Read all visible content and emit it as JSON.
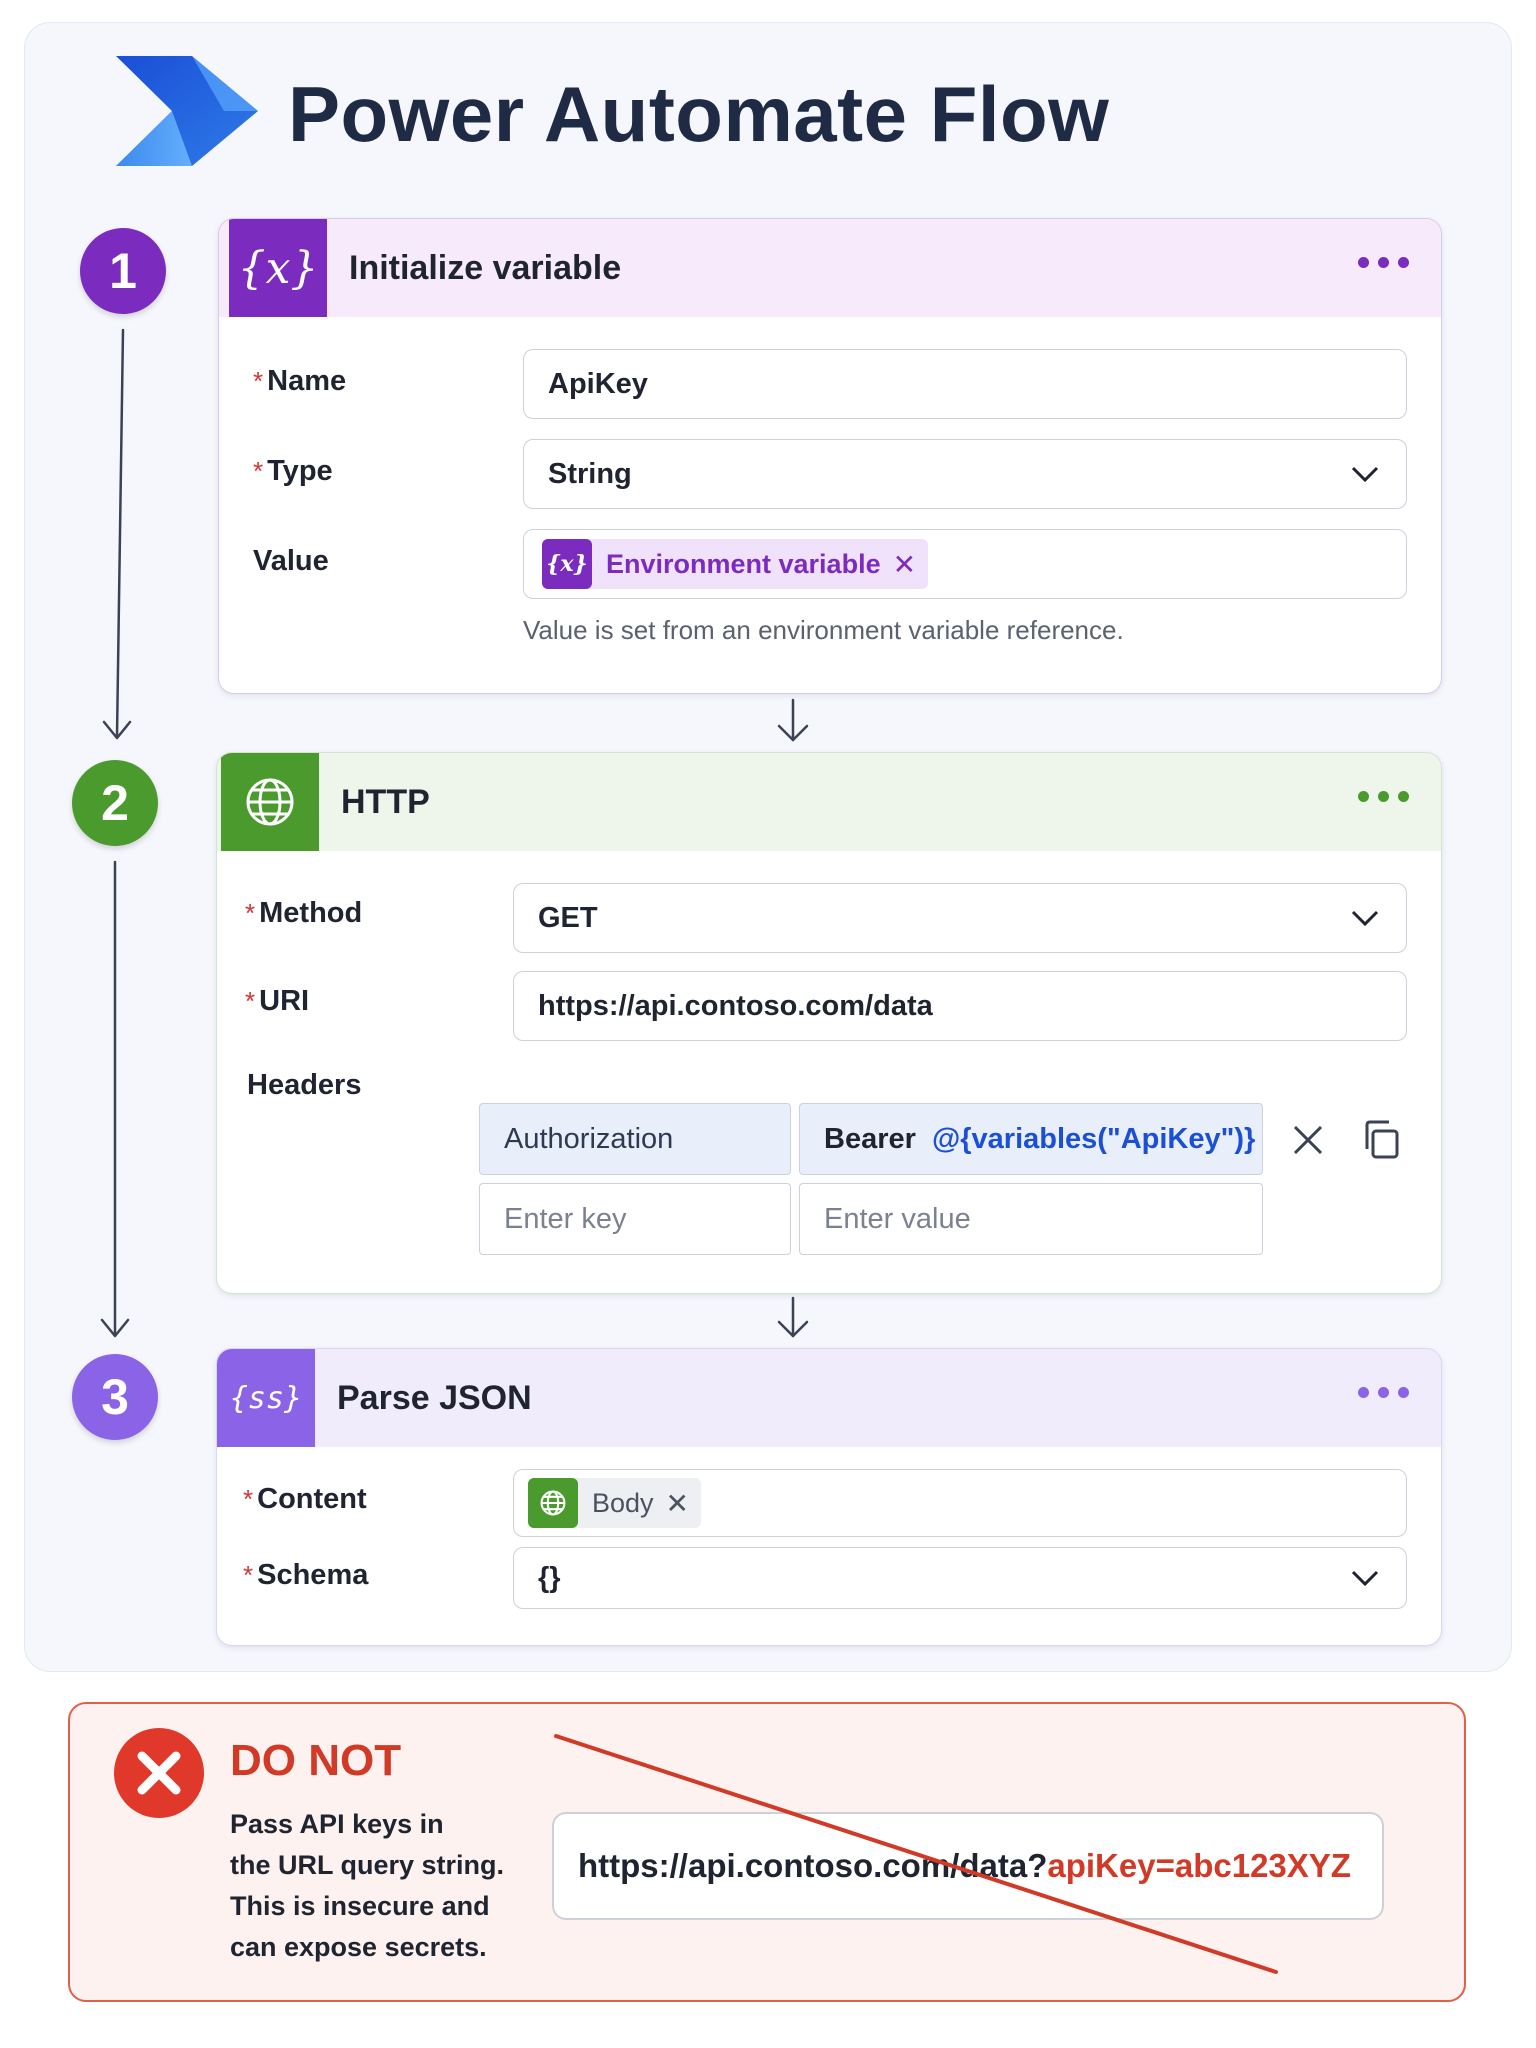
{
  "app": {
    "title": "Power Automate Flow",
    "logo_icon": "power-automate-logo"
  },
  "steps": [
    {
      "number": "1",
      "title": "Initialize variable",
      "icon": "variable-icon",
      "icon_text": "{x}",
      "accent": "#7b2cbf",
      "fields": {
        "name_label": "Name",
        "name_value": "ApiKey",
        "type_label": "Type",
        "type_value": "String",
        "value_label": "Value",
        "value_token": "Environment variable",
        "value_token_icon_text": "{x}",
        "value_hint": "Value is set from an environment variable reference."
      }
    },
    {
      "number": "2",
      "title": "HTTP",
      "icon": "globe-icon",
      "accent": "#4a9a2d",
      "fields": {
        "method_label": "Method",
        "method_value": "GET",
        "uri_label": "URI",
        "uri_value": "https://api.contoso.com/data",
        "headers_label": "Headers",
        "header_key": "Authorization",
        "header_value_prefix": "Bearer ",
        "header_value_expr": "@{variables(\"ApiKey\")}",
        "key_placeholder": "Enter key",
        "value_placeholder": "Enter value"
      }
    },
    {
      "number": "3",
      "title": "Parse JSON",
      "icon": "parse-json-icon",
      "icon_text": "{ss}",
      "accent": "#8a63e6",
      "fields": {
        "content_label": "Content",
        "content_token": "Body",
        "schema_label": "Schema",
        "schema_value": "{}"
      }
    }
  ],
  "warning": {
    "title": "DO NOT",
    "lines": [
      "Pass API keys in",
      "the URL query string.",
      "This is insecure and",
      "can expose secrets."
    ],
    "bad_url_base": "https://api.contoso.com/data?",
    "bad_url_param": "apiKey=abc123XYZ",
    "color": "#d13a27"
  }
}
